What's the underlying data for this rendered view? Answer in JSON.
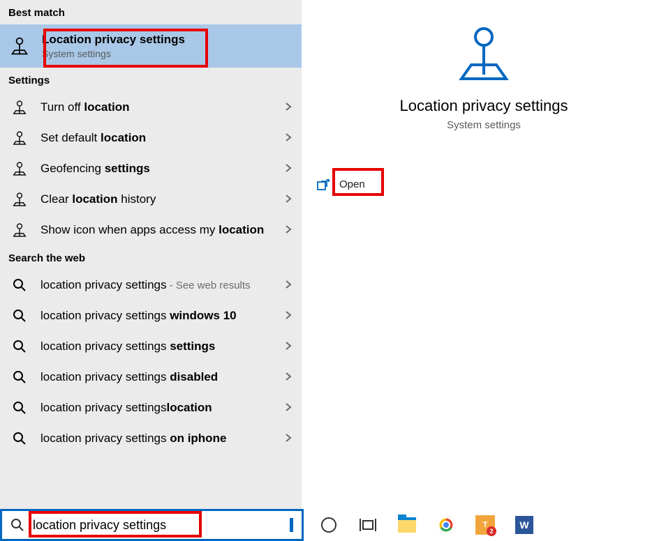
{
  "headers": {
    "best_match": "Best match",
    "settings": "Settings",
    "search_web": "Search the web"
  },
  "best_match": {
    "title": "Location privacy settings",
    "subtitle": "System settings"
  },
  "settings_items": [
    {
      "prefix": "Turn off ",
      "bold": "location",
      "suffix": ""
    },
    {
      "prefix": "Set default ",
      "bold": "location",
      "suffix": ""
    },
    {
      "prefix": "Geofencing ",
      "bold": "settings",
      "suffix": ""
    },
    {
      "prefix": "Clear ",
      "bold": "location",
      "suffix": " history"
    },
    {
      "prefix": "Show icon when apps access my ",
      "bold": "location",
      "suffix": ""
    }
  ],
  "web_items": [
    {
      "text": "location privacy settings",
      "bold": "",
      "suffix_gray": " - See web results"
    },
    {
      "text": "location privacy settings ",
      "bold": "windows 10",
      "suffix_gray": ""
    },
    {
      "text": "location privacy settings ",
      "bold": "settings",
      "suffix_gray": ""
    },
    {
      "text": "location privacy settings ",
      "bold": "disabled",
      "suffix_gray": ""
    },
    {
      "text": "location privacy settings",
      "bold": "location",
      "suffix_gray": ""
    },
    {
      "text": "location privacy settings ",
      "bold": "on iphone",
      "suffix_gray": ""
    }
  ],
  "detail": {
    "title": "Location privacy settings",
    "subtitle": "System settings",
    "open_label": "Open"
  },
  "search": {
    "value": "location privacy settings"
  },
  "taskbar": {
    "teams_badge": "2",
    "word_letter": "W"
  }
}
